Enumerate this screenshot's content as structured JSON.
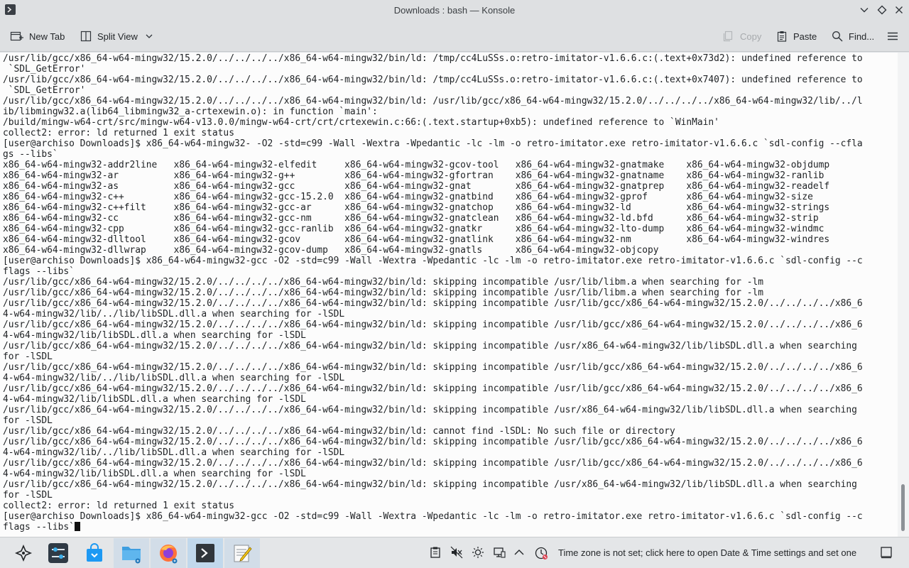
{
  "window": {
    "title": "Downloads : bash — Konsole"
  },
  "toolbar": {
    "new_tab": "New Tab",
    "split_view": "Split View",
    "copy": "Copy",
    "paste": "Paste",
    "find": "Find..."
  },
  "terminal": {
    "lines": [
      "/usr/lib/gcc/x86_64-w64-mingw32/15.2.0/../../../../x86_64-w64-mingw32/bin/ld: /tmp/cc4LuSSs.o:retro-imitator-v1.6.6.c:(.text+0x73d2): undefined reference to",
      " `SDL_GetError'",
      "/usr/lib/gcc/x86_64-w64-mingw32/15.2.0/../../../../x86_64-w64-mingw32/bin/ld: /tmp/cc4LuSSs.o:retro-imitator-v1.6.6.c:(.text+0x7407): undefined reference to",
      " `SDL_GetError'",
      "/usr/lib/gcc/x86_64-w64-mingw32/15.2.0/../../../../x86_64-w64-mingw32/bin/ld: /usr/lib/gcc/x86_64-w64-mingw32/15.2.0/../../../../x86_64-w64-mingw32/lib/../l",
      "ib/libmingw32.a(lib64_libmingw32_a-crtexewin.o): in function `main':",
      "/build/mingw-w64-crt/src/mingw-w64-v13.0.0/mingw-w64-crt/crt/crtexewin.c:66:(.text.startup+0xb5): undefined reference to `WinMain'",
      "collect2: error: ld returned 1 exit status",
      "[user@archiso Downloads]$ x86_64-w64-mingw32- -O2 -std=c99 -Wall -Wextra -Wpedantic -lc -lm -o retro-imitator.exe retro-imitator-v1.6.6.c `sdl-config --cfla",
      "gs --libs`",
      "x86_64-w64-mingw32-addr2line   x86_64-w64-mingw32-elfedit     x86_64-w64-mingw32-gcov-tool   x86_64-w64-mingw32-gnatmake    x86_64-w64-mingw32-objdump",
      "x86_64-w64-mingw32-ar          x86_64-w64-mingw32-g++         x86_64-w64-mingw32-gfortran    x86_64-w64-mingw32-gnatname    x86_64-w64-mingw32-ranlib",
      "x86_64-w64-mingw32-as          x86_64-w64-mingw32-gcc         x86_64-w64-mingw32-gnat        x86_64-w64-mingw32-gnatprep    x86_64-w64-mingw32-readelf",
      "x86_64-w64-mingw32-c++         x86_64-w64-mingw32-gcc-15.2.0  x86_64-w64-mingw32-gnatbind    x86_64-w64-mingw32-gprof       x86_64-w64-mingw32-size",
      "x86_64-w64-mingw32-c++filt     x86_64-w64-mingw32-gcc-ar      x86_64-w64-mingw32-gnatchop    x86_64-w64-mingw32-ld          x86_64-w64-mingw32-strings",
      "x86_64-w64-mingw32-cc          x86_64-w64-mingw32-gcc-nm      x86_64-w64-mingw32-gnatclean   x86_64-w64-mingw32-ld.bfd      x86_64-w64-mingw32-strip",
      "x86_64-w64-mingw32-cpp         x86_64-w64-mingw32-gcc-ranlib  x86_64-w64-mingw32-gnatkr      x86_64-w64-mingw32-lto-dump    x86_64-w64-mingw32-windmc",
      "x86_64-w64-mingw32-dlltool     x86_64-w64-mingw32-gcov        x86_64-w64-mingw32-gnatlink    x86_64-w64-mingw32-nm          x86_64-w64-mingw32-windres",
      "x86_64-w64-mingw32-dllwrap     x86_64-w64-mingw32-gcov-dump   x86_64-w64-mingw32-gnatls      x86_64-w64-mingw32-objcopy",
      "[user@archiso Downloads]$ x86_64-w64-mingw32-gcc -O2 -std=c99 -Wall -Wextra -Wpedantic -lc -lm -o retro-imitator.exe retro-imitator-v1.6.6.c `sdl-config --c",
      "flags --libs`",
      "/usr/lib/gcc/x86_64-w64-mingw32/15.2.0/../../../../x86_64-w64-mingw32/bin/ld: skipping incompatible /usr/lib/libm.a when searching for -lm",
      "/usr/lib/gcc/x86_64-w64-mingw32/15.2.0/../../../../x86_64-w64-mingw32/bin/ld: skipping incompatible /usr/lib/libm.a when searching for -lm",
      "/usr/lib/gcc/x86_64-w64-mingw32/15.2.0/../../../../x86_64-w64-mingw32/bin/ld: skipping incompatible /usr/lib/gcc/x86_64-w64-mingw32/15.2.0/../../../../x86_6",
      "4-w64-mingw32/lib/../lib/libSDL.dll.a when searching for -lSDL",
      "/usr/lib/gcc/x86_64-w64-mingw32/15.2.0/../../../../x86_64-w64-mingw32/bin/ld: skipping incompatible /usr/lib/gcc/x86_64-w64-mingw32/15.2.0/../../../../x86_6",
      "4-w64-mingw32/lib/libSDL.dll.a when searching for -lSDL",
      "/usr/lib/gcc/x86_64-w64-mingw32/15.2.0/../../../../x86_64-w64-mingw32/bin/ld: skipping incompatible /usr/x86_64-w64-mingw32/lib/libSDL.dll.a when searching",
      "for -lSDL",
      "/usr/lib/gcc/x86_64-w64-mingw32/15.2.0/../../../../x86_64-w64-mingw32/bin/ld: skipping incompatible /usr/lib/gcc/x86_64-w64-mingw32/15.2.0/../../../../x86_6",
      "4-w64-mingw32/lib/../lib/libSDL.dll.a when searching for -lSDL",
      "/usr/lib/gcc/x86_64-w64-mingw32/15.2.0/../../../../x86_64-w64-mingw32/bin/ld: skipping incompatible /usr/lib/gcc/x86_64-w64-mingw32/15.2.0/../../../../x86_6",
      "4-w64-mingw32/lib/libSDL.dll.a when searching for -lSDL",
      "/usr/lib/gcc/x86_64-w64-mingw32/15.2.0/../../../../x86_64-w64-mingw32/bin/ld: skipping incompatible /usr/x86_64-w64-mingw32/lib/libSDL.dll.a when searching",
      "for -lSDL",
      "/usr/lib/gcc/x86_64-w64-mingw32/15.2.0/../../../../x86_64-w64-mingw32/bin/ld: cannot find -lSDL: No such file or directory",
      "/usr/lib/gcc/x86_64-w64-mingw32/15.2.0/../../../../x86_64-w64-mingw32/bin/ld: skipping incompatible /usr/lib/gcc/x86_64-w64-mingw32/15.2.0/../../../../x86_6",
      "4-w64-mingw32/lib/../lib/libSDL.dll.a when searching for -lSDL",
      "/usr/lib/gcc/x86_64-w64-mingw32/15.2.0/../../../../x86_64-w64-mingw32/bin/ld: skipping incompatible /usr/lib/gcc/x86_64-w64-mingw32/15.2.0/../../../../x86_6",
      "4-w64-mingw32/lib/libSDL.dll.a when searching for -lSDL",
      "/usr/lib/gcc/x86_64-w64-mingw32/15.2.0/../../../../x86_64-w64-mingw32/bin/ld: skipping incompatible /usr/x86_64-w64-mingw32/lib/libSDL.dll.a when searching",
      "for -lSDL",
      "collect2: error: ld returned 1 exit status",
      "[user@archiso Downloads]$ x86_64-w64-mingw32-gcc -O2 -std=c99 -Wall -Wextra -Wpedantic -lc -lm -o retro-imitator.exe retro-imitator-v1.6.6.c `sdl-config --c"
    ],
    "last_line": "flags --libs`"
  },
  "taskbar": {
    "apps": [
      {
        "name": "application-launcher",
        "icon": "kde-launcher-icon"
      },
      {
        "name": "system-settings",
        "icon": "settings-sliders-icon"
      },
      {
        "name": "discover",
        "icon": "store-bag-icon"
      },
      {
        "name": "dolphin",
        "icon": "folder-icon"
      },
      {
        "name": "firefox",
        "icon": "firefox-icon"
      },
      {
        "name": "konsole",
        "icon": "terminal-icon"
      },
      {
        "name": "kate",
        "icon": "text-editor-icon"
      }
    ],
    "tray_message": "Time zone is not set; click here to open Date & Time settings and set one"
  },
  "colors": {
    "chrome": "#dee0e2",
    "terminal_bg": "#fcfcfc",
    "terminal_fg": "#1e2124",
    "active_task": "#c1d8ec"
  }
}
